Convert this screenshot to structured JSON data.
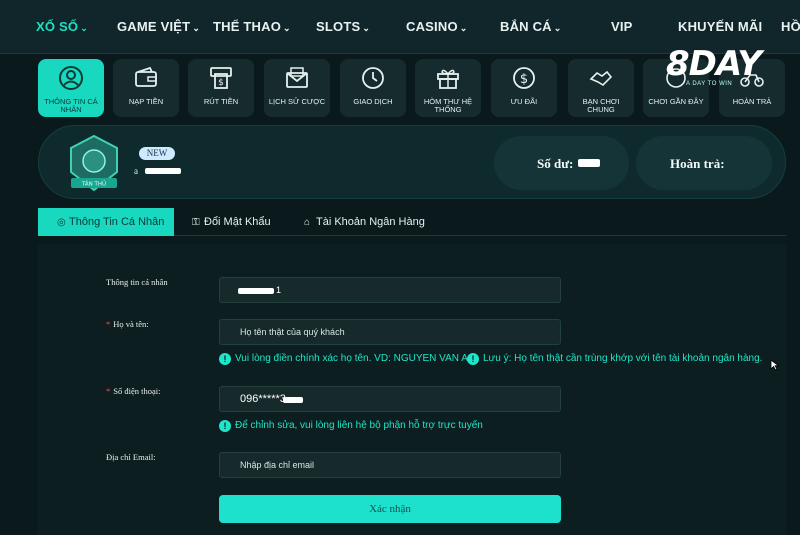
{
  "nav": {
    "items": [
      {
        "label": "XỔ SỐ",
        "chevron": true,
        "active": true
      },
      {
        "label": "GAME VIỆT",
        "chevron": true,
        "active": false
      },
      {
        "label": "THỂ THAO",
        "chevron": true,
        "active": false
      },
      {
        "label": "SLOTS",
        "chevron": true,
        "active": false
      },
      {
        "label": "CASINO",
        "chevron": true,
        "active": false
      },
      {
        "label": "BẮN CÁ",
        "chevron": true,
        "active": false
      },
      {
        "label": "VIP",
        "chevron": false,
        "active": false
      },
      {
        "label": "KHUYẾN MÃI",
        "chevron": false,
        "active": false
      },
      {
        "label": "HỒ",
        "chevron": false,
        "active": false
      }
    ],
    "chevron_glyph": "⌄"
  },
  "logo": {
    "text": "8DAY",
    "tagline": "A DAY TO WIN"
  },
  "quick_menu": [
    {
      "label": "THÔNG TIN CÁ NHÂN",
      "icon": "user-circle-icon",
      "active": true
    },
    {
      "label": "NẠP TIỀN",
      "icon": "wallet-icon",
      "active": false
    },
    {
      "label": "RÚT TIỀN",
      "icon": "atm-withdraw-icon",
      "active": false
    },
    {
      "label": "LỊCH SỬ CƯỢC",
      "icon": "envelope-icon",
      "active": false
    },
    {
      "label": "GIAO DỊCH",
      "icon": "clock-history-icon",
      "active": false
    },
    {
      "label": "HÒM THƯ HỆ THỐNG",
      "icon": "gift-box-icon",
      "active": false
    },
    {
      "label": "ƯU ĐÃI",
      "icon": "dollar-coin-icon",
      "active": false
    },
    {
      "label": "BẠN CHƠI CHUNG",
      "icon": "handshake-icon",
      "active": false
    },
    {
      "label": "CHƠI GẦN ĐÂY",
      "icon": "joystick-icon",
      "active": false
    },
    {
      "label": "HOÀN TRẢ",
      "icon": "motorbike-icon",
      "active": false
    }
  ],
  "profile": {
    "rank_label": "TÂN THỦ",
    "new_badge": "NEW",
    "username": "a",
    "balance_label": "Số dư:",
    "rebate_label": "Hoàn trả:"
  },
  "tabs": [
    {
      "label": "Thông Tin Cá Nhân",
      "icon": "user-circle-icon",
      "active": true
    },
    {
      "label": "Đổi Mật Khẩu",
      "icon": "key-icon",
      "active": false
    },
    {
      "label": "Tài Khoản Ngân Hàng",
      "icon": "bank-icon",
      "active": false
    }
  ],
  "form": {
    "section_label": "Thông tin cá nhân",
    "username_value": "1",
    "fullname_label": "Họ và tên:",
    "fullname_placeholder": "Họ tên thật của quý khách",
    "fullname_hint1": "Vui lòng điền chính xác họ tên. VD: NGUYEN VAN A",
    "fullname_hint2": "Lưu ý: Họ tên thật cần trùng khớp với tên tài khoản ngân hàng.",
    "phone_label": "Số điện thoại:",
    "phone_value": "096*****3",
    "phone_hint": "Để chỉnh sửa, vui lòng liên hệ bộ phận hỗ trợ trực tuyến",
    "email_label": "Địa chỉ Email:",
    "email_placeholder": "Nhập địa chỉ email",
    "submit_label": "Xác nhận",
    "required_mark": "*"
  },
  "colors": {
    "accent": "#18d9c0",
    "background": "#0a1a1c",
    "hint": "#1de6c9"
  }
}
